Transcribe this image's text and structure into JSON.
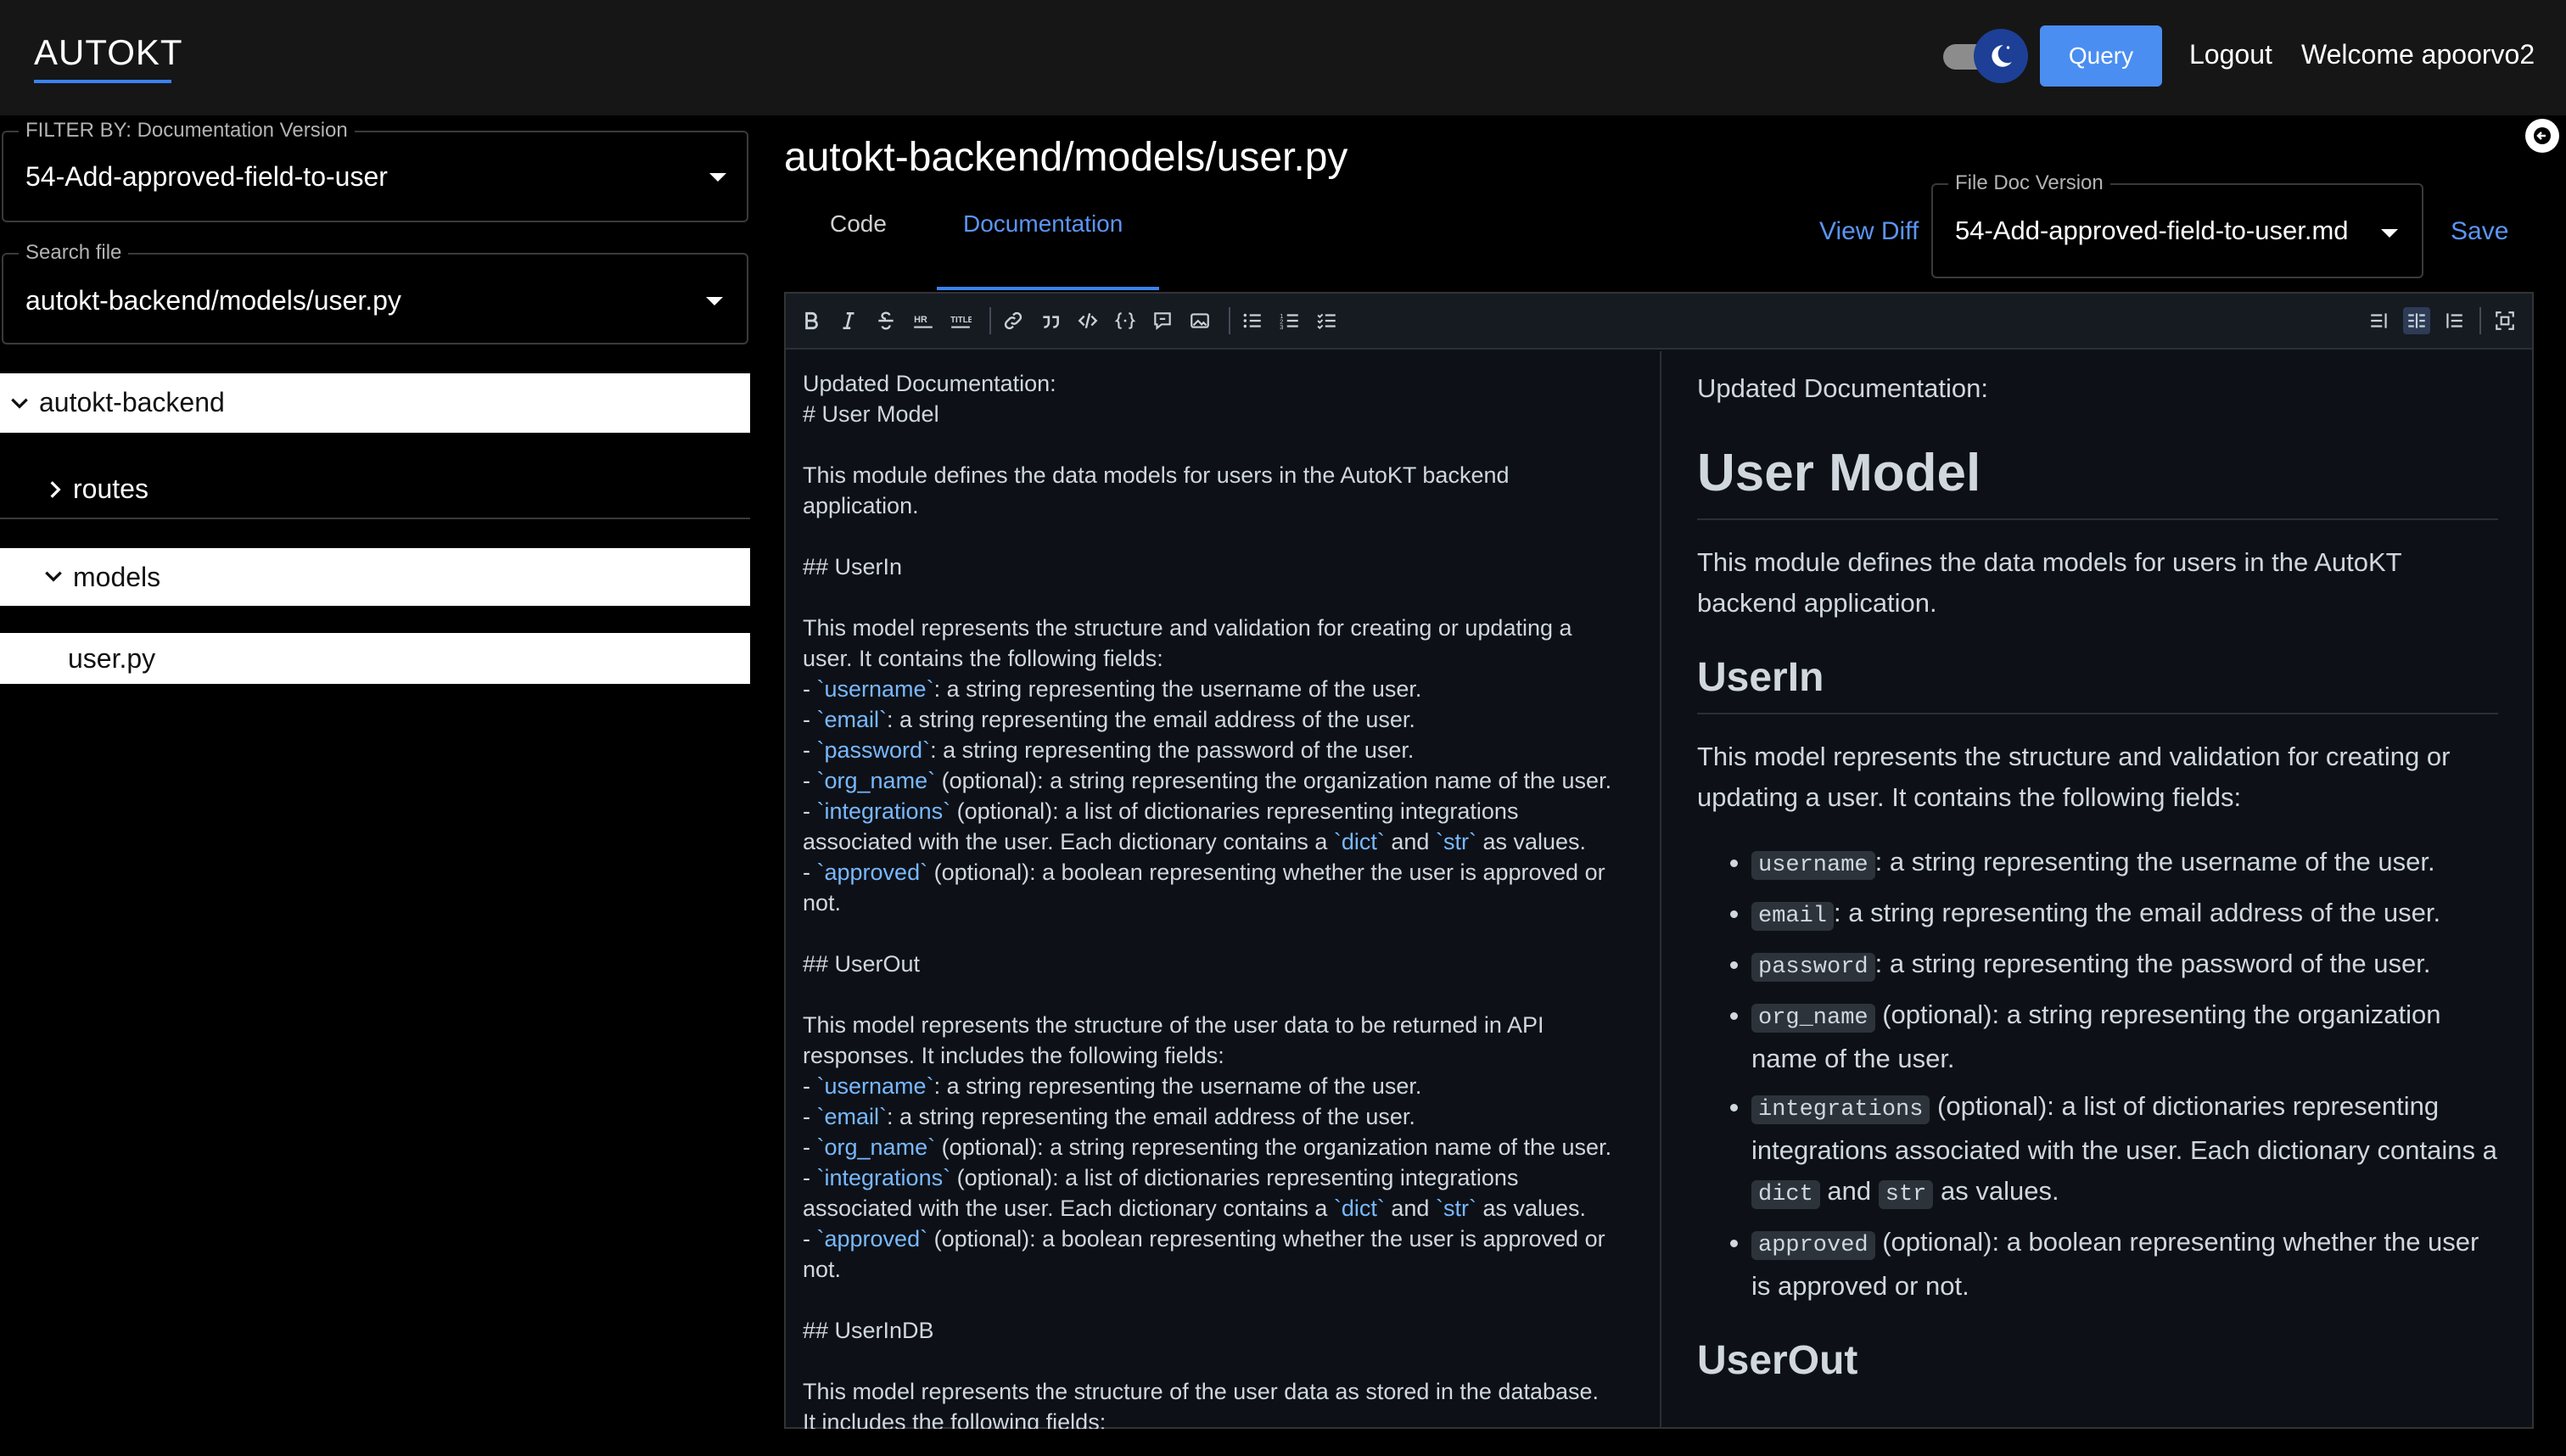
{
  "header": {
    "brand": "AUTOKT",
    "query_label": "Query",
    "logout_label": "Logout",
    "welcome_text": "Welcome apoorvo2"
  },
  "sidebar": {
    "filter_label": "FILTER BY: Documentation Version",
    "filter_value": "54-Add-approved-field-to-user",
    "search_label": "Search file",
    "search_value": "autokt-backend/models/user.py",
    "tree": {
      "root": "autokt-backend",
      "routes": "routes",
      "models": "models",
      "file": "user.py"
    }
  },
  "main": {
    "file_title": "autokt-backend/models/user.py",
    "tabs": [
      "Code",
      "Documentation"
    ],
    "active_tab": "Documentation",
    "view_diff_label": "View Diff",
    "file_doc_version_label": "File Doc Version",
    "file_doc_version_value": "54-Add-approved-field-to-user.md",
    "save_label": "Save"
  },
  "editor": {
    "toolbar_icons": [
      "bold-icon",
      "italic-icon",
      "strikethrough-icon",
      "hr-icon",
      "title-icon",
      "link-icon",
      "quote-icon",
      "code-icon",
      "code-block-icon",
      "comment-icon",
      "image-icon",
      "unordered-list-icon",
      "ordered-list-icon",
      "checklist-icon"
    ],
    "view_icons": [
      "edit-only-icon",
      "live-preview-icon",
      "preview-only-icon",
      "fullscreen-icon"
    ],
    "source": {
      "l1": "Updated Documentation:",
      "l2": "# User Model",
      "l3": "This module defines the data models for users in the AutoKT backend",
      "l4": "application.",
      "l5": "## UserIn",
      "l6": "This model represents the structure and validation for creating or updating a",
      "l7": "user. It contains the following fields:",
      "f_username": "username",
      "f_username_rest": ": a string representing the username of the user.",
      "f_email": "email",
      "f_email_rest": ": a string representing the email address of the user.",
      "f_password": "password",
      "f_password_rest": ": a string representing the password of the user.",
      "f_org": "org_name",
      "f_org_rest": " (optional): a string representing the organization name of the user.",
      "f_int": "integrations",
      "f_int_rest": " (optional): a list of dictionaries representing integrations",
      "f_int_line2_a": "associated with the user. Each dictionary contains a ",
      "f_dict": "dict",
      "f_and": " and ",
      "f_str": "str",
      "f_values": " as values.",
      "f_approved": "approved",
      "f_approved_rest": " (optional): a boolean representing whether the user is approved or",
      "f_not": "not.",
      "l8": "## UserOut",
      "l9": "This model represents the structure of the user data to be returned in API",
      "l10": "responses. It includes the following fields:",
      "l11": "## UserInDB",
      "l12": "This model represents the structure of the user data as stored in the database.",
      "l13": "It includes the following fields:"
    },
    "preview": {
      "intro": "Updated Documentation:",
      "h1": "User Model",
      "p1": "This module defines the data models for users in the AutoKT backend application.",
      "h2_userin": "UserIn",
      "p2": "This model represents the structure and validation for creating or updating a user. It contains the following fields:",
      "username": "username",
      "username_rest": ": a string representing the username of the user.",
      "email": "email",
      "email_rest": ": a string representing the email address of the user.",
      "password": "password",
      "password_rest": ": a string representing the password of the user.",
      "org_name": "org_name",
      "org_name_rest": " (optional): a string representing the organization name of the user.",
      "integrations": "integrations",
      "integrations_rest": " (optional): a list of dictionaries representing integrations associated with the user. Each dictionary contains a ",
      "dict": "dict",
      "and": " and ",
      "str": "str",
      "as_values": " as values.",
      "approved": "approved",
      "approved_rest": " (optional): a boolean representing whether the user is approved or not.",
      "h2_userout": "UserOut"
    }
  }
}
